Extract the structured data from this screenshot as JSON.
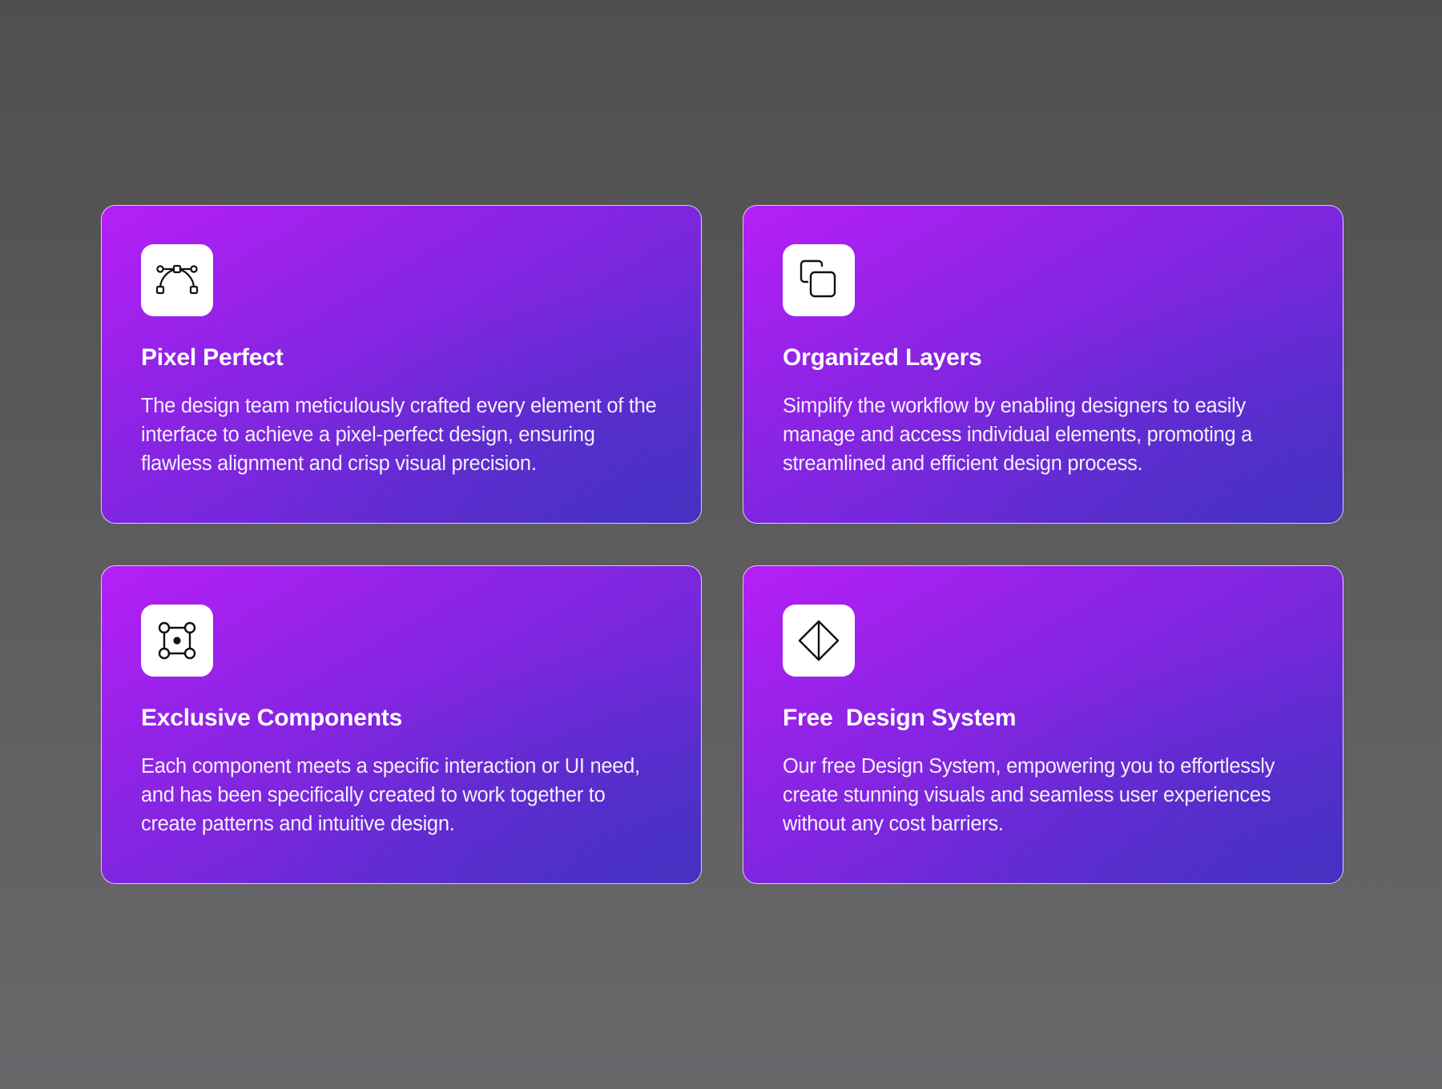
{
  "colors": {
    "background": "#5b5a5c",
    "card_gradient_start": "#b61ff6",
    "card_gradient_end": "#4e31c6",
    "icon_tile": "#ffffff",
    "text": "#ffffff"
  },
  "features": [
    {
      "icon": "bezier-curve-icon",
      "title": "Pixel Perfect",
      "description": "The design team meticulously crafted every element of the interface to achieve a pixel-perfect design, ensuring flawless alignment and crisp visual precision."
    },
    {
      "icon": "layers-copy-icon",
      "title": "Organized Layers",
      "description": "Simplify the workflow by enabling designers to easily manage and access individual elements, promoting a streamlined and efficient design process."
    },
    {
      "icon": "component-nodes-icon",
      "title": "Exclusive Components",
      "description": "Each component meets a specific interaction or UI need, and has been specifically created to work together to create patterns and intuitive design."
    },
    {
      "icon": "diamond-prism-icon",
      "title": "Free  Design System",
      "description": "Our free Design System, empowering you to effortlessly create stunning visuals and seamless user experiences without any cost barriers."
    }
  ]
}
